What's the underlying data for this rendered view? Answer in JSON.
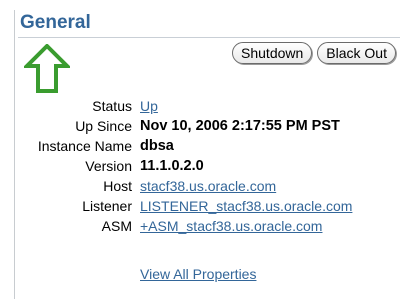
{
  "section": {
    "title": "General"
  },
  "buttons": {
    "shutdown": "Shutdown",
    "blackout": "Black Out"
  },
  "colors": {
    "title": "#336699",
    "link": "#336699",
    "arrow": "#3a9c2f"
  },
  "icons": {
    "indicator": "up-arrow-icon"
  },
  "properties": {
    "status": {
      "label": "Status",
      "value": "Up"
    },
    "up_since": {
      "label": "Up Since",
      "value": "Nov 10, 2006 2:17:55 PM PST"
    },
    "instance": {
      "label": "Instance Name",
      "value": "dbsa"
    },
    "version": {
      "label": "Version",
      "value": "11.1.0.2.0"
    },
    "host": {
      "label": "Host",
      "value": "stacf38.us.oracle.com"
    },
    "listener": {
      "label": "Listener",
      "value": "LISTENER_stacf38.us.oracle.com"
    },
    "asm": {
      "label": "ASM",
      "value": "+ASM_stacf38.us.oracle.com"
    }
  },
  "links": {
    "view_all": "View All Properties"
  }
}
